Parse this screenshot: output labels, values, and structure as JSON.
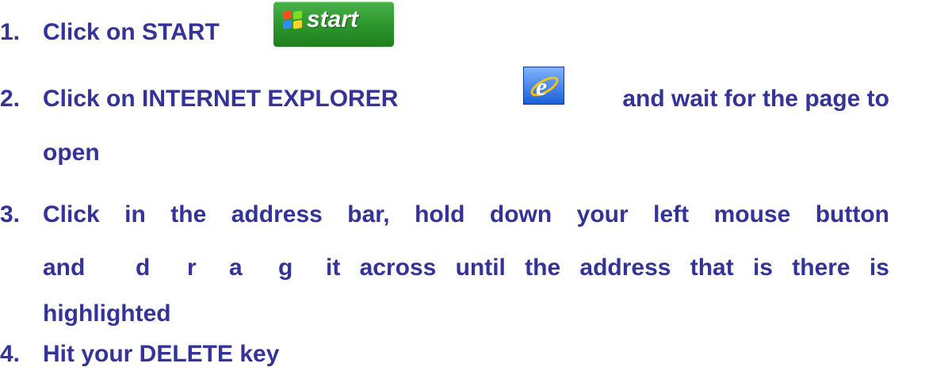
{
  "steps": [
    {
      "number": "1.",
      "text": "Click on START",
      "button_label": "start",
      "icon": "windows-start-button"
    },
    {
      "number": "2.",
      "text_before": "Click on INTERNET EXPLORER",
      "text_after": "and wait for the page to",
      "continuation": "open",
      "icon": "internet-explorer-icon"
    },
    {
      "number": "3.",
      "line1": [
        "Click",
        "in",
        "the",
        "address",
        "bar,",
        "hold",
        "down",
        "your",
        "left",
        "mouse",
        "button"
      ],
      "line2_start": "and",
      "drag_letters": [
        "d",
        "r",
        "a",
        "g"
      ],
      "line2_rest": [
        "it",
        "across",
        "until",
        "the",
        "address",
        "that",
        "is",
        "there",
        "is"
      ],
      "line3": "highlighted"
    },
    {
      "number": "4.",
      "text": "Hit your DELETE key"
    }
  ],
  "colors": {
    "text": "#33339a",
    "start_button": "#2f9a2f",
    "ie_icon": "#1b5fd6"
  }
}
